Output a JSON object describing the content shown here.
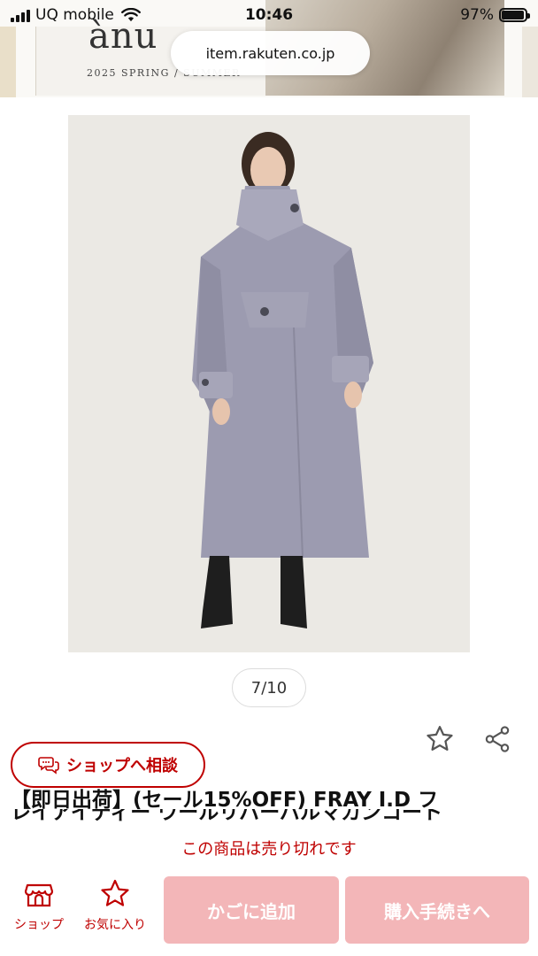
{
  "status_bar": {
    "carrier": "UQ mobile",
    "time": "10:46",
    "battery": "97%",
    "battery_level": 0.97
  },
  "browser": {
    "url": "item.rakuten.co.jp"
  },
  "banner": {
    "logo": "ànu",
    "subtitle": "2025 SPRING / SUMMER"
  },
  "gallery": {
    "counter": "7/10"
  },
  "actions": {
    "favorite_icon": "star-outline-icon",
    "share_icon": "share-icon"
  },
  "chat": {
    "label": "ショップへ相談"
  },
  "product": {
    "title_line1": "【即日出荷】(セール15%OFF) FRAY I.D フ",
    "title_line2": "レイアイディー ウールリバーバルマカンコート"
  },
  "bottom": {
    "sold_out": "この商品は売り切れです",
    "shop_label": "ショップ",
    "favorite_label": "お気に入り",
    "cart_label": "かごに追加",
    "buy_label": "購入手続きへ"
  },
  "colors": {
    "accent": "#bf0000",
    "disabled_button": "#f3b6b8"
  }
}
